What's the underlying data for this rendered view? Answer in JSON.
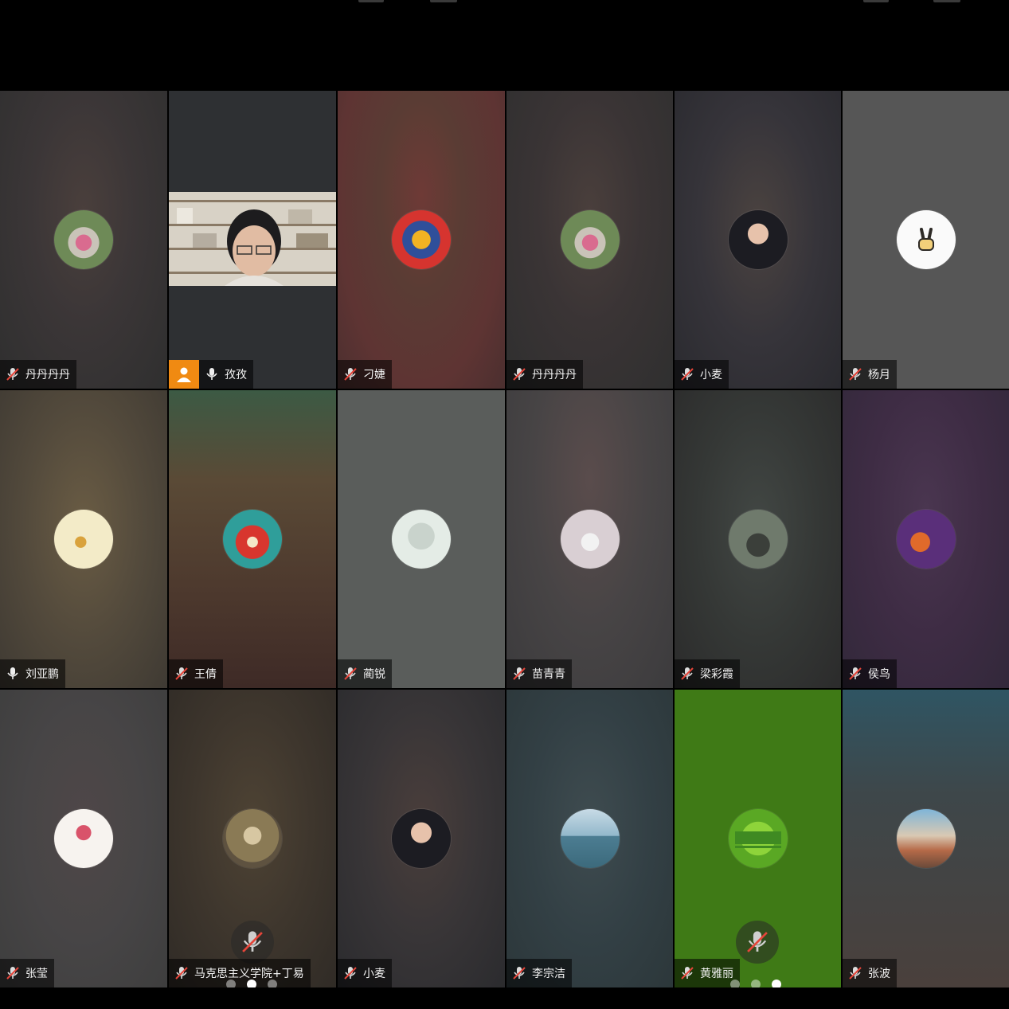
{
  "participants": [
    {
      "name": "丹丹丹丹",
      "muted": true
    },
    {
      "name": "孜孜",
      "muted": false,
      "host": true,
      "video": true
    },
    {
      "name": "刁婕",
      "muted": true
    },
    {
      "name": "丹丹丹丹",
      "muted": true
    },
    {
      "name": "小麦",
      "muted": true
    },
    {
      "name": "杨月",
      "muted": true
    },
    {
      "name": "刘亚鹏",
      "muted": false
    },
    {
      "name": "王倩",
      "muted": true
    },
    {
      "name": "蔺锐",
      "muted": true
    },
    {
      "name": "苗青青",
      "muted": true
    },
    {
      "name": "梁彩霞",
      "muted": true
    },
    {
      "name": "侯鸟",
      "muted": true
    },
    {
      "name": "张莹",
      "muted": true
    },
    {
      "name": "马克思主义学院+丁易",
      "muted": true
    },
    {
      "name": "小麦",
      "muted": true
    },
    {
      "name": "李宗洁",
      "muted": true
    },
    {
      "name": "黄雅丽",
      "muted": true
    },
    {
      "name": "张波",
      "muted": true
    }
  ],
  "page_indicators": {
    "count": 3,
    "active_index_left": 1,
    "active_index_right": 2
  },
  "colors": {
    "host_badge": "#f08a12",
    "mute_red": "#e5453a",
    "green_tile": "#3f7a16"
  },
  "icons": [
    "microphone-icon",
    "muted-microphone-icon",
    "host-person-icon"
  ]
}
